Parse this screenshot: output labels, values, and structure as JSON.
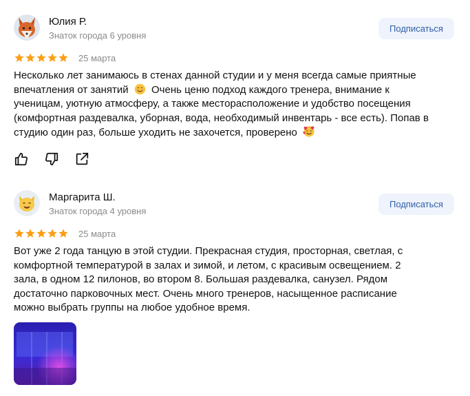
{
  "reviews": [
    {
      "author": "Юлия Р.",
      "level": "Знаток города 6 уровня",
      "subscribe_label": "Подписаться",
      "stars": 5,
      "date": "25 марта",
      "text_lines": [
        "Несколько лет занимаюсь в стенах данной студии и у меня всегда самые приятные",
        "впечатления от занятий",
        "Очень ценю подход каждого тренера, внимание к",
        "ученицам, уютную атмосферу, а также месторасположение и удобство посещения",
        "(комфортная раздевалка, уборная, вода, необходимый инвентарь - все есть). Попав в",
        "студию один раз, больше уходить не захочется, проверено"
      ],
      "avatar_icon": "fox-icon"
    },
    {
      "author": "Маргарита Ш.",
      "level": "Знаток города 4 уровня",
      "subscribe_label": "Подписаться",
      "stars": 5,
      "date": "25 марта",
      "text_lines": [
        "Вот уже 2 года танцую в этой студии. Прекрасная студия, просторная, светлая, с",
        "комфортной температурой в залах и зимой, и летом, с красивым освещением. 2",
        "зала, в одном 12 пилонов, во втором 8. Большая раздевалка, санузел. Рядом",
        "достаточно парковочных мест. Очень много тренеров, насыщенное расписание",
        "можно выбрать группы на любое удобное время."
      ],
      "avatar_icon": "cat-icon"
    }
  ],
  "colors": {
    "star": "#fc9e16",
    "subscribe_bg": "#eef3fc",
    "subscribe_text": "#2f5fa8",
    "muted": "#8a8a8a"
  },
  "icons": [
    "thumb-up-icon",
    "thumb-down-icon",
    "share-icon"
  ]
}
